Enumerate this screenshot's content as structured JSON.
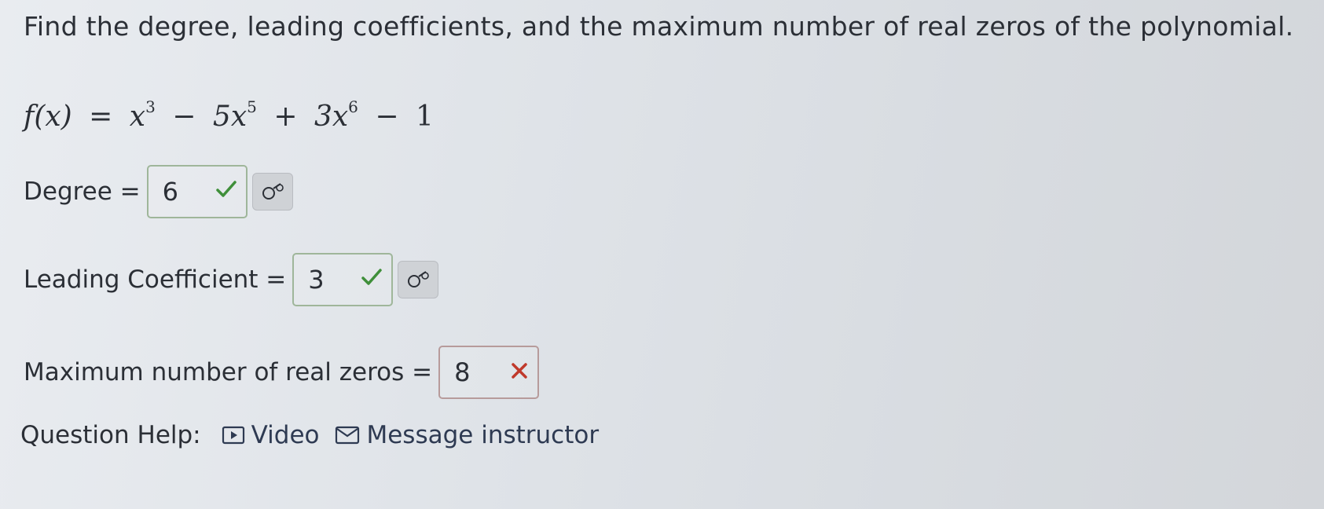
{
  "question": {
    "text": "Find the degree, leading coefficients, and the maximum number of real zeros of the polynomial."
  },
  "equation": {
    "lhs": "f(x)",
    "equals": "=",
    "t1_base": "x",
    "t1_exp": "3",
    "op1": "−",
    "t2_base": "5x",
    "t2_exp": "5",
    "op2": "+",
    "t3_base": "3x",
    "t3_exp": "6",
    "op3": "−",
    "t4": "1"
  },
  "degree": {
    "label": "Degree =",
    "value": "6",
    "status": "correct"
  },
  "leading_coefficient": {
    "label": "Leading Coefficient =",
    "value": "3",
    "status": "correct"
  },
  "max_real_zeros": {
    "label": "Maximum number of real zeros =",
    "value": "8",
    "status": "incorrect"
  },
  "help": {
    "label": "Question Help:",
    "video_label": "Video",
    "message_label": "Message instructor",
    "video_icon": "video-icon",
    "message_icon": "envelope-icon"
  },
  "colors": {
    "correct": "#3f8f3a",
    "incorrect": "#c0392b"
  }
}
